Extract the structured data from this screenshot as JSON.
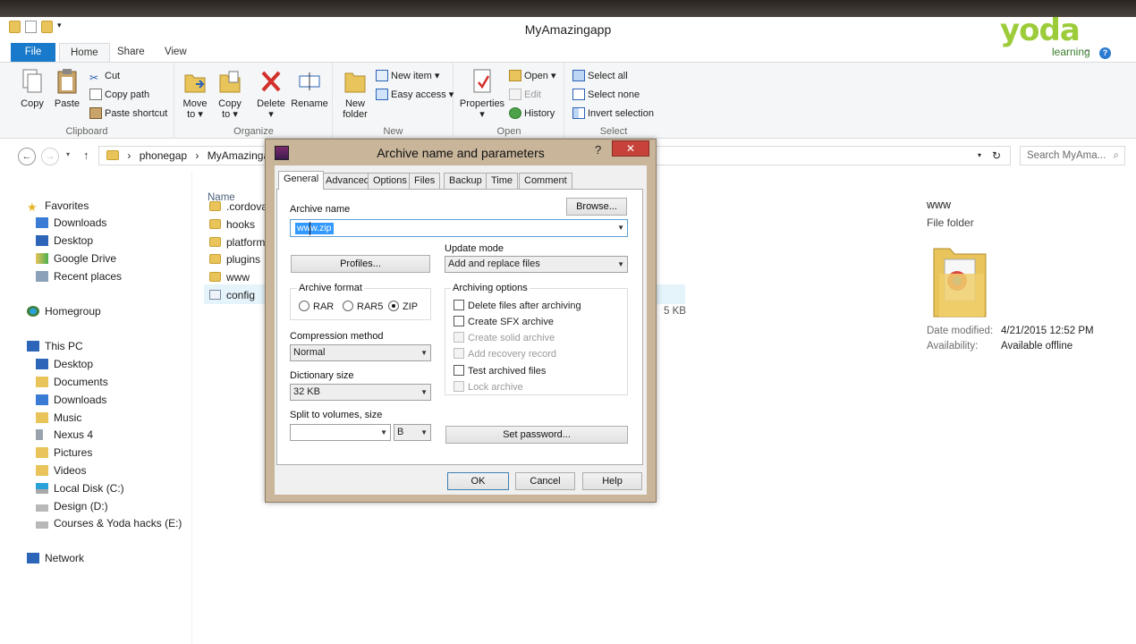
{
  "window": {
    "title": "MyAmazingapp",
    "logo": {
      "brand": "yoda",
      "sub": "learning"
    }
  },
  "ribbon": {
    "tabs": [
      "File",
      "Home",
      "Share",
      "View"
    ],
    "clipboard": {
      "label": "Clipboard",
      "copy": "Copy",
      "paste": "Paste",
      "cut": "Cut",
      "copy_path": "Copy path",
      "paste_shortcut": "Paste shortcut"
    },
    "organize": {
      "label": "Organize",
      "move_to": "Move",
      "move_to2": "to ▾",
      "copy_to": "Copy",
      "copy_to2": "to ▾",
      "delete": "Delete",
      "delete2": "▾",
      "rename": "Rename"
    },
    "new": {
      "label": "New",
      "new_folder": "New",
      "new_folder2": "folder",
      "new_item": "New item ▾",
      "easy_access": "Easy access ▾"
    },
    "open": {
      "label": "Open",
      "properties": "Properties",
      "properties2": "▾",
      "open": "Open ▾",
      "edit": "Edit",
      "history": "History"
    },
    "select": {
      "label": "Select",
      "select_all": "Select all",
      "select_none": "Select none",
      "invert": "Invert selection"
    }
  },
  "address": {
    "crumbs": [
      "phonegap",
      "MyAmazingapp"
    ],
    "search_placeholder": "Search MyAma..."
  },
  "nav": {
    "favorites": "Favorites",
    "fav_items": [
      "Downloads",
      "Desktop",
      "Google Drive",
      "Recent places"
    ],
    "homegroup": "Homegroup",
    "this_pc": "This PC",
    "pc_items": [
      "Desktop",
      "Documents",
      "Downloads",
      "Music",
      "Nexus 4",
      "Pictures",
      "Videos",
      "Local Disk (C:)",
      "Design (D:)",
      "Courses & Yoda hacks (E:)"
    ],
    "network": "Network"
  },
  "content": {
    "col_name": "Name",
    "files": [
      ".cordova",
      "hooks",
      "platform",
      "plugins",
      "www",
      "config"
    ],
    "size_fragment": "5 KB"
  },
  "details": {
    "name": "www",
    "type": "File folder",
    "date_label": "Date modified:",
    "date_value": "4/21/2015 12:52 PM",
    "avail_label": "Availability:",
    "avail_value": "Available offline"
  },
  "dialog": {
    "title": "Archive name and parameters",
    "help_q": "?",
    "close": "✕",
    "tabs": [
      "General",
      "Advanced",
      "Options",
      "Files",
      "Backup",
      "Time",
      "Comment"
    ],
    "browse": "Browse...",
    "archive_name_label": "Archive name",
    "archive_name_value": "www.zip",
    "profiles": "Profiles...",
    "update_mode_label": "Update mode",
    "update_mode_value": "Add and replace files",
    "archive_format_label": "Archive format",
    "formats": [
      "RAR",
      "RAR5",
      "ZIP"
    ],
    "selected_format": "ZIP",
    "compression_label": "Compression method",
    "compression_value": "Normal",
    "dict_label": "Dictionary size",
    "dict_value": "32 KB",
    "split_label": "Split to volumes, size",
    "split_value": "",
    "split_unit": "B",
    "archiving_options_label": "Archiving options",
    "options": [
      {
        "label": "Delete files after archiving",
        "enabled": true
      },
      {
        "label": "Create SFX archive",
        "enabled": true
      },
      {
        "label": "Create solid archive",
        "enabled": false
      },
      {
        "label": "Add recovery record",
        "enabled": false
      },
      {
        "label": "Test archived files",
        "enabled": true
      },
      {
        "label": "Lock archive",
        "enabled": false
      }
    ],
    "set_password": "Set password...",
    "ok": "OK",
    "cancel": "Cancel",
    "help": "Help"
  },
  "colors": {
    "accent": "#1979ca",
    "selection": "#e5f3fb",
    "dialog_frame": "#c8b59a",
    "close_red": "#c7423a"
  }
}
